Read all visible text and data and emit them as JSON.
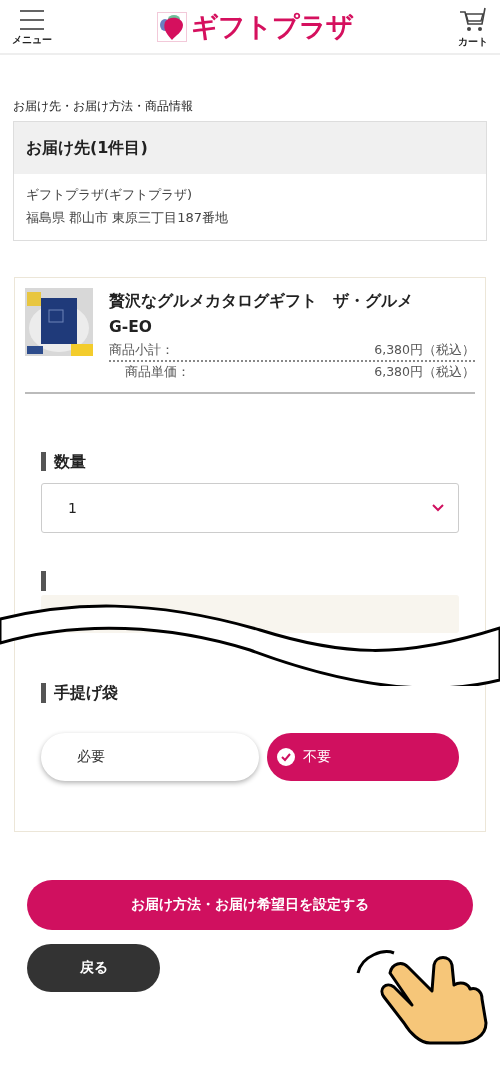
{
  "header": {
    "menu_label": "メニュー",
    "logo_text": "ギフトプラザ",
    "cart_label": "カート"
  },
  "breadcrumb": "お届け先・お届け方法・商品情報",
  "destination": {
    "title": "お届け先(1件目)",
    "name": "ギフトプラザ(ギフトプラザ)",
    "address": "福島県 郡山市 東原三丁目187番地"
  },
  "product": {
    "title": "贅沢なグルメカタログギフト　ザ・グルメ\nG-EO",
    "price_rows": [
      {
        "label": "商品小計：",
        "value": "6,380円（税込）"
      },
      {
        "label": "商品単価：",
        "value": "6,380円（税込）"
      }
    ]
  },
  "quantity": {
    "label": "数量",
    "value": "1"
  },
  "bag": {
    "label": "手提げ袋",
    "options": [
      {
        "label": "必要",
        "selected": false
      },
      {
        "label": "不要",
        "selected": true
      }
    ]
  },
  "buttons": {
    "primary": "お届け方法・お届け希望日を設定する",
    "back": "戻る"
  }
}
